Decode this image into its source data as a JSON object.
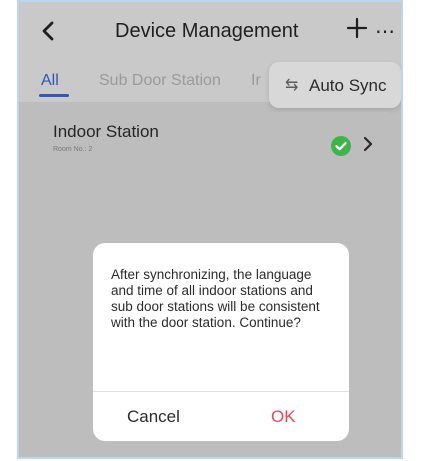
{
  "nav": {
    "title": "Device Management"
  },
  "tabs": [
    {
      "label": "All",
      "active": true
    },
    {
      "label": "Sub Door Station",
      "active": false
    },
    {
      "label": "Ir",
      "active": false
    }
  ],
  "popover": {
    "label": "Auto Sync"
  },
  "devices": [
    {
      "name": "Indoor Station",
      "room": "Room No.: 2",
      "status": "online"
    }
  ],
  "modal": {
    "text": "After synchronizing, the language and time of all indoor stations and sub door stations will be consistent with the door station. Continue?",
    "cancel_label": "Cancel",
    "ok_label": "OK"
  },
  "colors": {
    "accent": "#2d58b8",
    "success": "#3db54a",
    "danger": "#e5484d"
  },
  "icons": {
    "back": "chevron-left-icon",
    "add": "plus-icon",
    "more": "more-icon",
    "sync": "sync-icon",
    "status": "check-circle-icon",
    "row_next": "chevron-right-icon"
  }
}
